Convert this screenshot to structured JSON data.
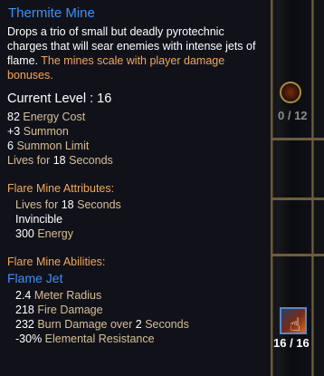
{
  "hud": {
    "top_slot_counter": "0 / 12",
    "skill_slot_counter": "16 / 16"
  },
  "tooltip": {
    "title": "Thermite Mine",
    "description": "Drops a trio of small but deadly pyrotechnic charges that will sear enemies with intense jets of flame.",
    "description_highlight": "The mines scale with player damage bonuses.",
    "current_level_label": "Current Level : 16",
    "stats": [
      {
        "value": "82",
        "label": "Energy Cost"
      },
      {
        "value": "+3",
        "label": "Summon"
      },
      {
        "value": "6",
        "label": "Summon Limit"
      },
      {
        "prefix": "Lives for",
        "value": "18",
        "label": "Seconds"
      }
    ],
    "attributes_header": "Flare Mine Attributes:",
    "attributes": [
      {
        "prefix": "Lives for",
        "value": "18",
        "label": "Seconds"
      },
      {
        "label_white": "Invincible"
      },
      {
        "value": "300",
        "label": "Energy"
      }
    ],
    "abilities_header": "Flare Mine Abilities:",
    "ability_name": "Flame Jet",
    "ability_stats": [
      {
        "value": "2.4",
        "label": "Meter Radius"
      },
      {
        "value": "218",
        "label": "Fire Damage"
      },
      {
        "value": "232",
        "label": "Burn Damage over",
        "value2": "2",
        "label2": "Seconds"
      },
      {
        "value": "-30%",
        "label": "Elemental Resistance"
      }
    ]
  }
}
